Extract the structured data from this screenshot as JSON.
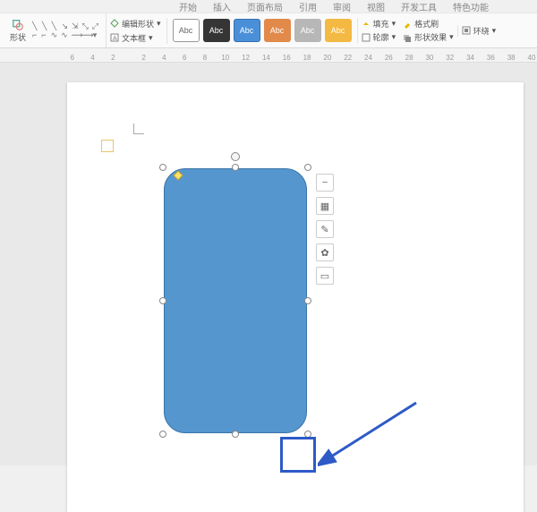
{
  "tabs": {
    "t1": "开始",
    "t2": "插入",
    "t3": "页面布局",
    "t4": "引用",
    "t5": "审阅",
    "t6": "视图",
    "t7": "开发工具",
    "t8": "特色功能"
  },
  "ribbon": {
    "shapes_label": "形状",
    "edit_shape": "编辑形状",
    "text_box": "文本框",
    "swatch_text": "Abc",
    "fill": "填充",
    "outline": "轮廓",
    "format_painter": "格式刷",
    "shape_effect": "形状效果",
    "wrap": "环绕"
  },
  "ruler": {
    "marks": [
      "6",
      "",
      "4",
      "",
      "2",
      "",
      "",
      "2",
      "",
      "4",
      "",
      "6",
      "",
      "8",
      "",
      "10",
      "",
      "12",
      "",
      "14",
      "",
      "16",
      "",
      "18",
      "",
      "20",
      "",
      "22",
      "",
      "24",
      "",
      "26",
      "",
      "28",
      "",
      "30",
      "",
      "32",
      "",
      "34",
      "",
      "36",
      "",
      "38",
      "",
      "40"
    ]
  },
  "float_tb": {
    "b1": "−",
    "b2": "▦",
    "b3": "✎",
    "b4": "✿",
    "b5": "▭"
  }
}
